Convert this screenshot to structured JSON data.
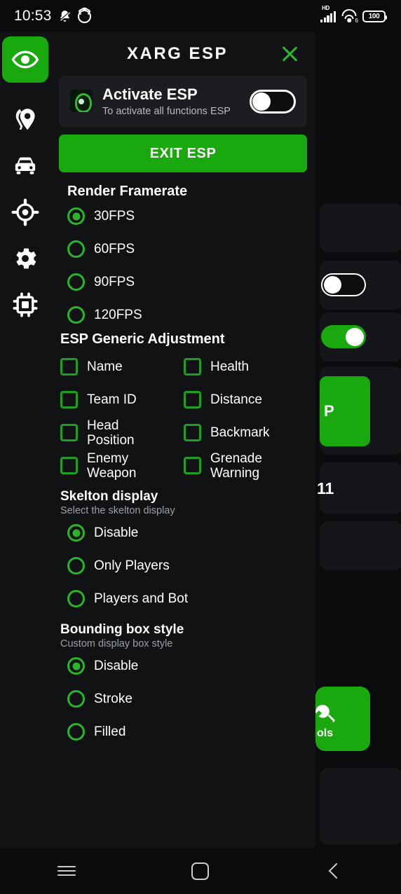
{
  "statusbar": {
    "time": "10:53",
    "mute_icon": "mute-bell-icon",
    "alarm_icon": "alarm-clock-icon",
    "network_label": "HD",
    "wifi_label": "6",
    "battery_level": "100"
  },
  "rail": {
    "active_icon": "eye-icon",
    "items": [
      {
        "icon": "location-pin-icon"
      },
      {
        "icon": "car-icon"
      },
      {
        "icon": "crosshair-icon"
      },
      {
        "icon": "gear-icon"
      },
      {
        "icon": "chip-icon"
      }
    ]
  },
  "panel": {
    "title": "XARG ESP",
    "close_icon": "close-icon",
    "activate": {
      "logo_icon": "app-logo-icon",
      "title": "Activate ESP",
      "subtitle": "To activate all functions ESP",
      "toggle_state": "off"
    },
    "exit_button": "EXIT ESP",
    "framerate": {
      "title": "Render Framerate",
      "options": [
        {
          "label": "30FPS",
          "selected": true
        },
        {
          "label": "60FPS",
          "selected": false
        },
        {
          "label": "90FPS",
          "selected": false
        },
        {
          "label": "120FPS",
          "selected": false
        }
      ]
    },
    "generic": {
      "title": "ESP Generic Adjustment",
      "items": [
        {
          "label": "Name",
          "checked": false
        },
        {
          "label": "Health",
          "checked": false
        },
        {
          "label": "Team ID",
          "checked": false
        },
        {
          "label": "Distance",
          "checked": false
        },
        {
          "label": "Head Position",
          "checked": false
        },
        {
          "label": "Backmark",
          "checked": false
        },
        {
          "label": "Enemy Weapon",
          "checked": false
        },
        {
          "label": "Grenade Warning",
          "checked": false
        }
      ]
    },
    "skelton": {
      "title": "Skelton display",
      "subtitle": "Select the skelton display",
      "options": [
        {
          "label": "Disable",
          "selected": true
        },
        {
          "label": "Only Players",
          "selected": false
        },
        {
          "label": "Players and Bot",
          "selected": false
        }
      ]
    },
    "boundingbox": {
      "title": "Bounding box style",
      "subtitle": "Custom display box style",
      "options": [
        {
          "label": "Disable",
          "selected": true
        },
        {
          "label": "Stroke",
          "selected": false
        },
        {
          "label": "Filled",
          "selected": false
        }
      ]
    }
  },
  "background": {
    "green_button_text": "P",
    "version_text": "11",
    "tools_text": "ols",
    "tools_icon": "wrench-icon"
  },
  "navbar": {
    "recents_icon": "recents-icon",
    "home_icon": "home-icon",
    "back_icon": "back-icon"
  },
  "colors": {
    "accent": "#1aa80f",
    "radio": "#2cb32c",
    "panel": "#111214",
    "card": "#1b1d20",
    "page": "#0a0b0d"
  }
}
